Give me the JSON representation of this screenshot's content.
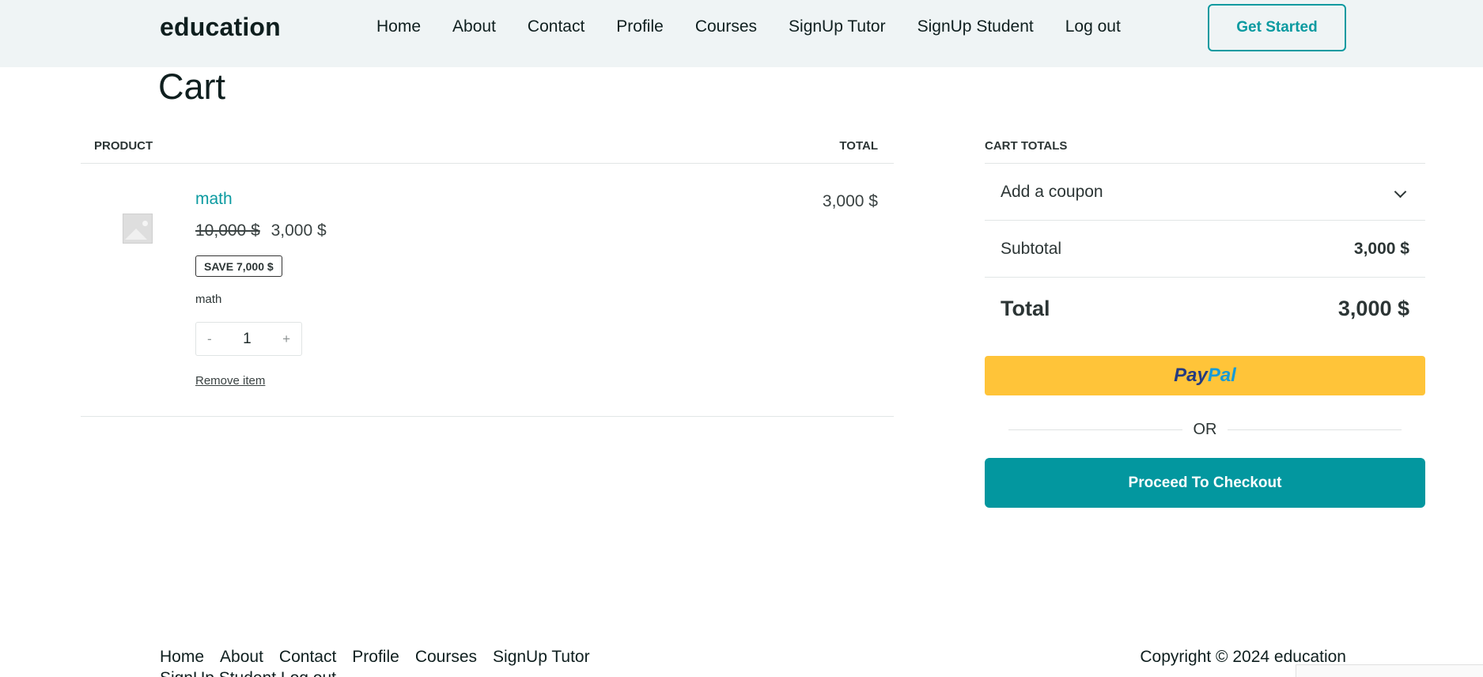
{
  "header": {
    "logo": "education",
    "nav": [
      "Home",
      "About",
      "Contact",
      "Profile",
      "Courses",
      "SignUp Tutor",
      "SignUp Student",
      "Log out"
    ],
    "cta_label": "Get Started"
  },
  "page": {
    "title": "Cart"
  },
  "cart_table": {
    "col_product": "PRODUCT",
    "col_total": "TOTAL",
    "item": {
      "name": "math",
      "original_price": "10,000 $",
      "sale_price": "3,000 $",
      "save_badge": "SAVE 7,000 $",
      "description": "math",
      "qty_minus": "-",
      "qty_plus": "+",
      "quantity": "1",
      "remove_label": "Remove item",
      "line_total": "3,000 $"
    }
  },
  "totals": {
    "heading": "CART TOTALS",
    "coupon_label": "Add a coupon",
    "subtotal_label": "Subtotal",
    "subtotal_value": "3,000 $",
    "total_label": "Total",
    "total_value": "3,000 $",
    "paypal_part1": "Pay",
    "paypal_part2": "Pal",
    "or_label": "OR",
    "checkout_label": "Proceed To Checkout"
  },
  "footer": {
    "nav": [
      "Home",
      "About",
      "Contact",
      "Profile",
      "Courses",
      "SignUp Tutor"
    ],
    "nav_second_line": "SignUp Student    Log out",
    "copyright": "Copyright © 2024 education"
  },
  "colors": {
    "accent": "#0b9aa0",
    "header_bg": "#eff4f5",
    "paypal_yellow": "#ffc439",
    "checkout_bg": "#03979f"
  }
}
